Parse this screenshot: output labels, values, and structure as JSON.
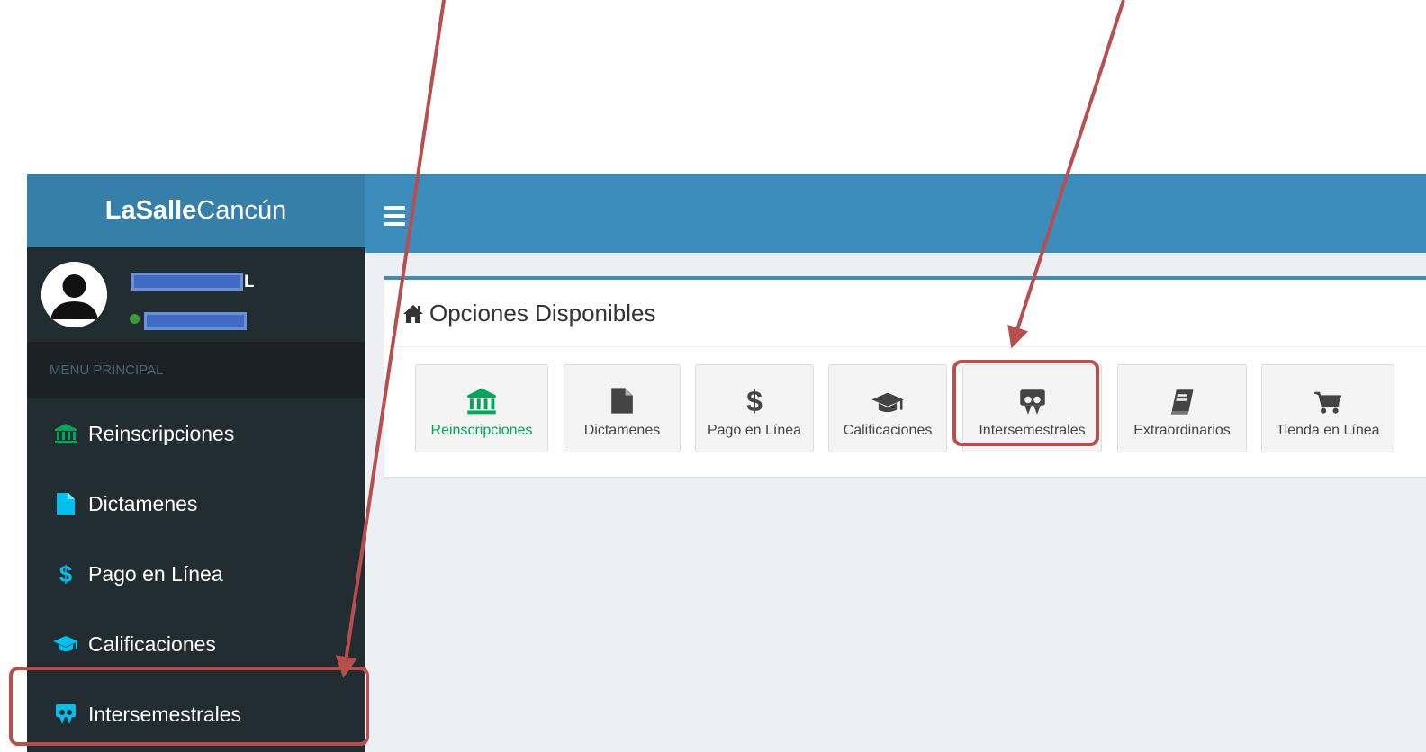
{
  "brand": {
    "bold": "LaSalle",
    "regular": "Cancún"
  },
  "user": {
    "initial_suffix": "L"
  },
  "sidebar": {
    "header": "MENU PRINCIPAL",
    "items": [
      {
        "label": "Reinscripciones",
        "icon": "bank-icon",
        "color": "#00a65a"
      },
      {
        "label": "Dictamenes",
        "icon": "file-icon",
        "color": "#00c0ef"
      },
      {
        "label": "Pago en Línea",
        "icon": "dollar-icon",
        "color": "#00c0ef"
      },
      {
        "label": "Calificaciones",
        "icon": "graduation-cap-icon",
        "color": "#00c0ef"
      },
      {
        "label": "Intersemestrales",
        "icon": "slideshare-icon",
        "color": "#00c0ef"
      }
    ]
  },
  "main": {
    "box_title": "Opciones Disponibles",
    "apps": [
      {
        "label": "Reinscripciones",
        "icon": "bank-icon"
      },
      {
        "label": "Dictamenes",
        "icon": "file-icon"
      },
      {
        "label": "Pago en Línea",
        "icon": "dollar-icon"
      },
      {
        "label": "Calificaciones",
        "icon": "graduation-cap-icon"
      },
      {
        "label": "Intersemestrales",
        "icon": "slideshare-icon"
      },
      {
        "label": "Extraordinarios",
        "icon": "book-icon"
      },
      {
        "label": "Tienda en Línea",
        "icon": "cart-icon"
      }
    ]
  },
  "colors": {
    "header_blue": "#3c8dbc",
    "brand_blue": "#367fa9",
    "sidebar_dark": "#222d32",
    "annotation_red": "#b74f4f",
    "green": "#00a65a",
    "aqua": "#00c0ef"
  }
}
